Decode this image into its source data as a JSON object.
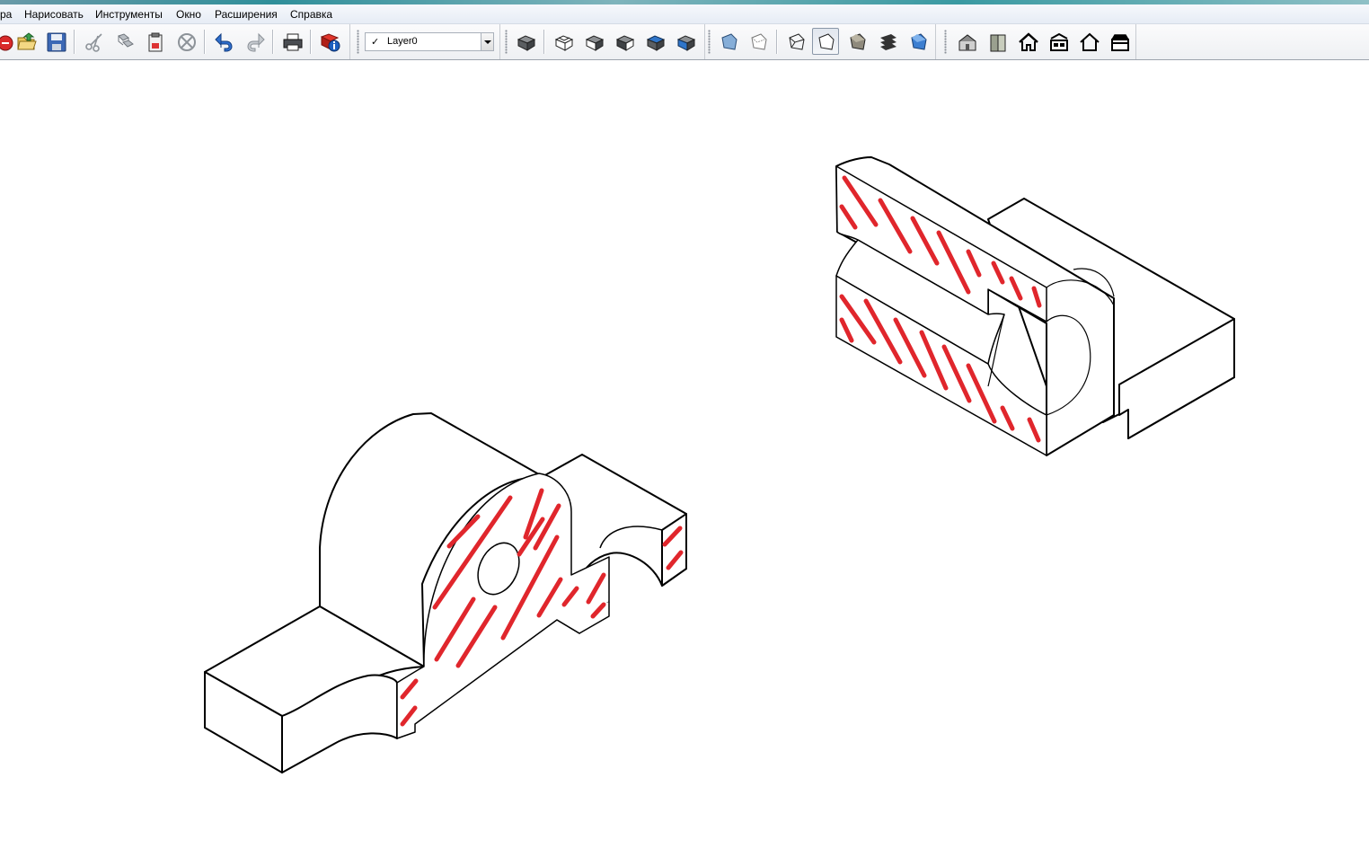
{
  "app": {
    "menu": [
      {
        "id": "view",
        "label": "ра"
      },
      {
        "id": "draw",
        "label": "Нарисовать"
      },
      {
        "id": "tools",
        "label": "Инструменты"
      },
      {
        "id": "window",
        "label": "Окно"
      },
      {
        "id": "extensions",
        "label": "Расширения"
      },
      {
        "id": "help",
        "label": "Справка"
      }
    ]
  },
  "toolbar": {
    "standard": [
      "new-icon",
      "open-icon",
      "save-icon",
      "cut-icon",
      "copy-icon",
      "paste-icon",
      "erase-icon",
      "undo-icon",
      "redo-icon",
      "print-icon",
      "model-info-icon"
    ],
    "layers": {
      "current_layer": "Layer0",
      "visible_check": "✓"
    },
    "views_group": [
      "view-iso-icon",
      "view-top-icon",
      "view-front-icon",
      "view-right-icon",
      "view-back-icon",
      "view-left-icon"
    ],
    "style_group": [
      "xray-icon",
      "back-edges-icon",
      "wireframe-icon",
      "hidden-line-icon",
      "shaded-icon",
      "shaded-textures-icon",
      "monochrome-icon"
    ],
    "active_style": "hidden-line-icon",
    "standard_views": [
      "warehouse-icon",
      "component-icon",
      "home-view-icon",
      "section-icon",
      "outline-house-icon",
      "share-model-icon"
    ]
  },
  "colors": {
    "hatch": "#e0262c",
    "edge": "#000000",
    "face": "#ffffff",
    "accent_blue": "#3d7fd1"
  }
}
